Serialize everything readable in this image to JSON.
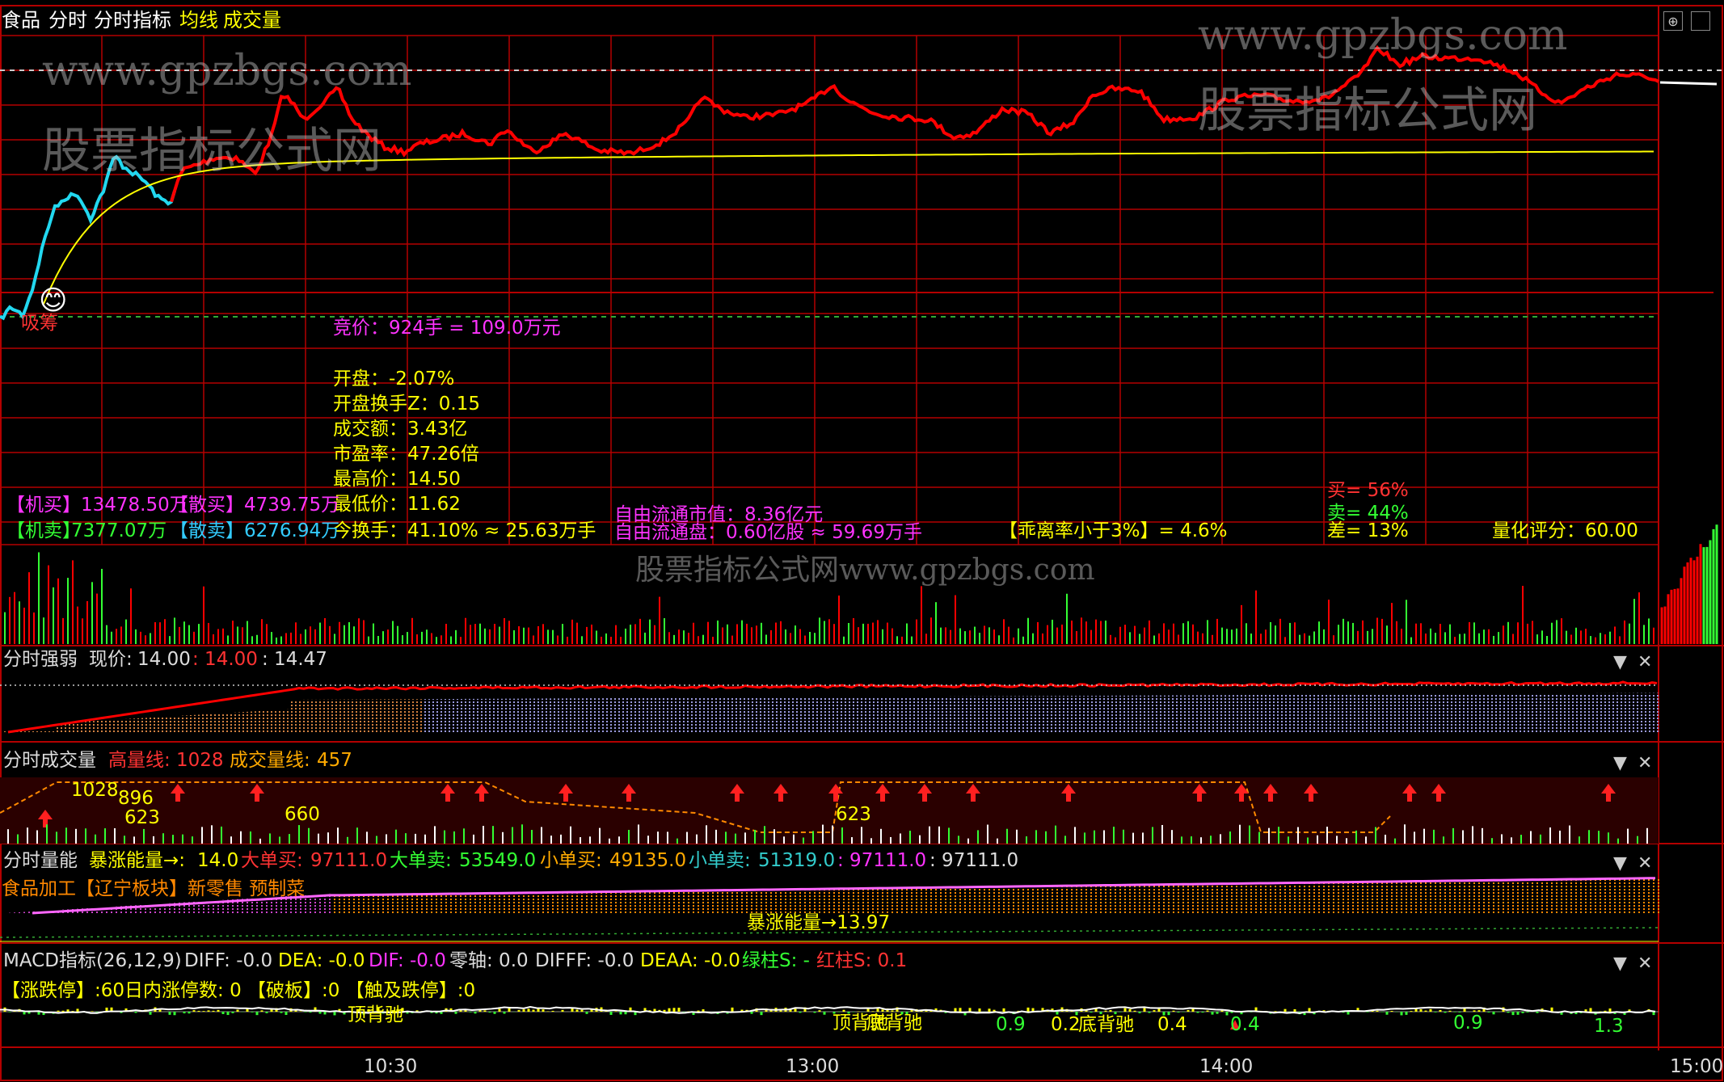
{
  "colors": {
    "bg": "#000000",
    "grid": "#b40000",
    "price": "#ff0000",
    "early": "#22d8f0",
    "avg": "#ffff00",
    "white": "#ffffff",
    "magenta": "#ff33ff",
    "green": "#33ff33",
    "yellow": "#ffff00",
    "gray": "#c8c8c8",
    "orange": "#ff8800",
    "lilac": "#9999dd"
  },
  "header": {
    "name": "食品",
    "tab1": "分时",
    "tab2": "分时指标",
    "avg": "均线",
    "vol": "成交量"
  },
  "watermark": {
    "url": "www.gpzbgs.com",
    "cn": "股票指标公式网",
    "footer": "股票指标公式网www.gpzbgs.com"
  },
  "main": {
    "jingjia": "竞价：924手 = 109.0万元",
    "suck": "吸筹",
    "stats": [
      "开盘：-2.07%",
      "开盘换手Z：0.15",
      "成交额：3.43亿",
      "市盈率：47.26倍",
      "最高价：14.50",
      "最低价：11.62",
      "今换手：41.10% ≈ 25.63万手"
    ],
    "jimai_l": "【机买】",
    "jimai_v": "13478.50万",
    "sanmai_l": "【散买】",
    "sanmai_v": "4739.75万",
    "jimai2_l": "【机卖】",
    "jimai2_v": "7377.07万",
    "sanmai2_l": "【散卖】",
    "sanmai2_v": "6276.94万",
    "float_val": "自由流通市值：8.36亿元",
    "float_share": "自由流通盘：0.60亿股 ≈ 59.69万手",
    "deviation": "【乖离率小于3%】= 4.6%",
    "buy": "买= 56%",
    "sell": "卖= 44%",
    "diff": "差= 13%",
    "score": "量化评分：60.00"
  },
  "panel1": {
    "title": "分时强弱",
    "now_l": "现价:",
    "now_v": "14.00",
    "v2": ": 14.00",
    "v3": ": 14.47"
  },
  "panel2": {
    "title": "分时成交量",
    "high_l": "高量线:",
    "high_v": "1028",
    "vol_l": "成交量线:",
    "vol_v": "457",
    "labels": [
      "1028",
      "896",
      "660",
      "623",
      "623"
    ]
  },
  "panel3": {
    "title": "分时量能",
    "a_l": "暴涨能量→:",
    "a_v": "14.0",
    "b_l": "大单买:",
    "b_v": "97111.0",
    "c_l": "大单卖:",
    "c_v": "53549.0",
    "d_l": "小单买:",
    "d_v": "49135.0",
    "e_l": "小单卖:",
    "e_v": "51319.0",
    "f": ": 97111.0",
    "g": ": 97111.0",
    "sector": "食品加工【辽宁板块】新零售 预制菜",
    "energy": "暴涨能量→13.97"
  },
  "panel4": {
    "title": "MACD指标(26,12,9)",
    "diff": "DIFF: -0.0",
    "dea": "DEA: -0.0",
    "dif": "DIF: -0.0",
    "zero": "零轴: 0.0",
    "difff": "DIFFF: -0.0",
    "deaa": "DEAA: -0.0",
    "green": "绿柱S: -",
    "red": "红柱S: 0.1",
    "limit": "【涨跌停】:60日内涨停数: 0 【破板】:0 【触及跌停】:0",
    "top1": "顶背驰",
    "top2": "顶背驰",
    "bottom": "底背驰",
    "nums": [
      "0.9",
      "0.2",
      "0.4",
      "0.4",
      "0.9",
      "1.3"
    ]
  },
  "time_axis": [
    "10:30",
    "13:00",
    "14:00",
    "15:00"
  ],
  "controls": {
    "dropdown": "▼",
    "close": "✕"
  }
}
